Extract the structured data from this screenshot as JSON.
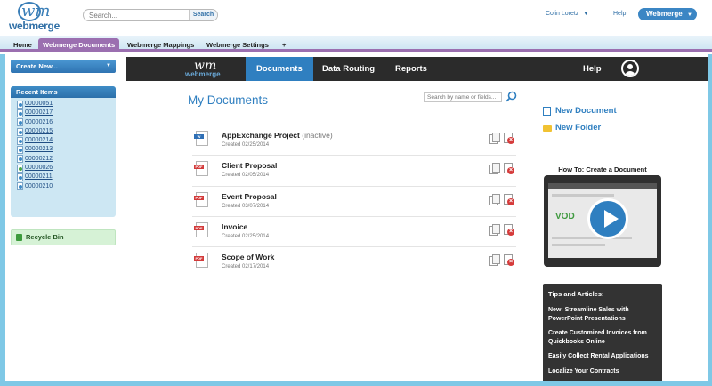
{
  "header": {
    "logo_text": "webmerge",
    "logo_mark": "wm",
    "search_placeholder": "Search...",
    "search_button": "Search",
    "user_name": "Colin Loretz",
    "help": "Help",
    "webmerge_button": "Webmerge",
    "caret": "▼"
  },
  "tabs": [
    {
      "label": "Home"
    },
    {
      "label": "Webmerge Documents"
    },
    {
      "label": "Webmerge Mappings"
    },
    {
      "label": "Webmerge Settings"
    },
    {
      "label": "+"
    }
  ],
  "sidebar": {
    "create_label": "Create New...",
    "recent_title": "Recent Items",
    "recent_items": [
      {
        "label": "00000051",
        "icon": "document-icon"
      },
      {
        "label": "00000217",
        "icon": "document-icon"
      },
      {
        "label": "00000216",
        "icon": "document-icon"
      },
      {
        "label": "00000215",
        "icon": "document-icon"
      },
      {
        "label": "00000214",
        "icon": "document-icon"
      },
      {
        "label": "00000213",
        "icon": "document-icon"
      },
      {
        "label": "00000212",
        "icon": "document-icon"
      },
      {
        "label": "00000026",
        "icon": "mapping-icon"
      },
      {
        "label": "00000211",
        "icon": "document-icon"
      },
      {
        "label": "00000210",
        "icon": "document-icon"
      }
    ],
    "recycle_bin": "Recycle Bin"
  },
  "nav": {
    "logo_mark": "wm",
    "logo_text": "webmerge",
    "documents": "Documents",
    "data_routing": "Data Routing",
    "reports": "Reports",
    "help": "Help"
  },
  "main": {
    "title": "My Documents",
    "search_placeholder": "Search by name or fields...",
    "documents": [
      {
        "name": "AppExchange Project",
        "status": "(inactive)",
        "date": "Created 02/25/2014",
        "type": "word",
        "tag": "W"
      },
      {
        "name": "Client Proposal",
        "status": "",
        "date": "Created 02/05/2014",
        "type": "pdf",
        "tag": "PDF"
      },
      {
        "name": "Event Proposal",
        "status": "",
        "date": "Created 03/07/2014",
        "type": "pdf",
        "tag": "PDF"
      },
      {
        "name": "Invoice",
        "status": "",
        "date": "Created 02/25/2014",
        "type": "pdf",
        "tag": "PDF"
      },
      {
        "name": "Scope of Work",
        "status": "",
        "date": "Created 02/17/2014",
        "type": "pdf",
        "tag": "PDF"
      }
    ]
  },
  "right": {
    "new_document": "New Document",
    "new_folder": "New Folder",
    "video_title": "How To: Create a Document",
    "video_logo": "VOD",
    "tips_title": "Tips and Articles:",
    "tips": [
      "New: Streamline Sales with PowerPoint Presentations",
      "Create Customized Invoices from Quickbooks Online",
      "Easily Collect Rental Applications",
      "Localize Your Contracts"
    ]
  },
  "colors": {
    "accent_blue": "#2f7fc0",
    "tab_purple": "#9b6fb0",
    "nav_dark": "#2b2b2b",
    "frame_blue": "#7fc8e6"
  }
}
